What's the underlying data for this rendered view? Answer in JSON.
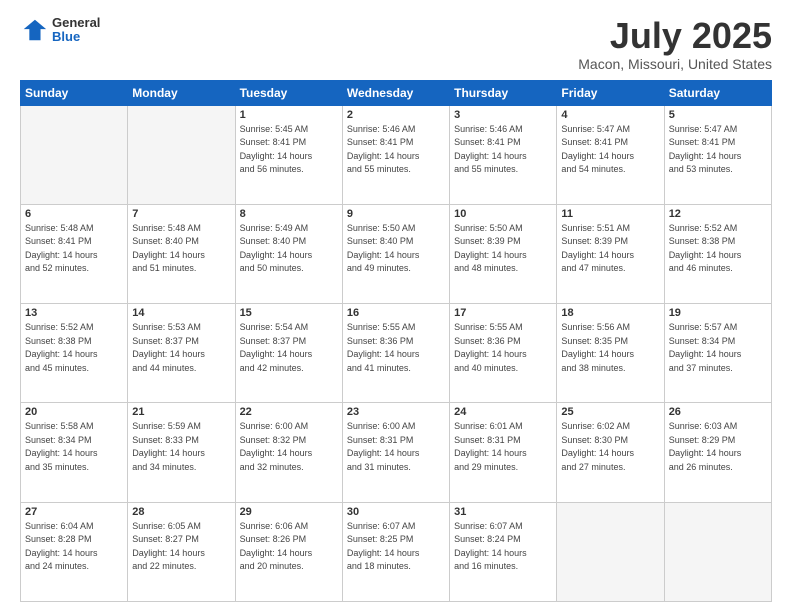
{
  "header": {
    "logo_general": "General",
    "logo_blue": "Blue",
    "title": "July 2025",
    "subtitle": "Macon, Missouri, United States"
  },
  "days_of_week": [
    "Sunday",
    "Monday",
    "Tuesday",
    "Wednesday",
    "Thursday",
    "Friday",
    "Saturday"
  ],
  "weeks": [
    [
      {
        "num": "",
        "info": ""
      },
      {
        "num": "",
        "info": ""
      },
      {
        "num": "1",
        "info": "Sunrise: 5:45 AM\nSunset: 8:41 PM\nDaylight: 14 hours\nand 56 minutes."
      },
      {
        "num": "2",
        "info": "Sunrise: 5:46 AM\nSunset: 8:41 PM\nDaylight: 14 hours\nand 55 minutes."
      },
      {
        "num": "3",
        "info": "Sunrise: 5:46 AM\nSunset: 8:41 PM\nDaylight: 14 hours\nand 55 minutes."
      },
      {
        "num": "4",
        "info": "Sunrise: 5:47 AM\nSunset: 8:41 PM\nDaylight: 14 hours\nand 54 minutes."
      },
      {
        "num": "5",
        "info": "Sunrise: 5:47 AM\nSunset: 8:41 PM\nDaylight: 14 hours\nand 53 minutes."
      }
    ],
    [
      {
        "num": "6",
        "info": "Sunrise: 5:48 AM\nSunset: 8:41 PM\nDaylight: 14 hours\nand 52 minutes."
      },
      {
        "num": "7",
        "info": "Sunrise: 5:48 AM\nSunset: 8:40 PM\nDaylight: 14 hours\nand 51 minutes."
      },
      {
        "num": "8",
        "info": "Sunrise: 5:49 AM\nSunset: 8:40 PM\nDaylight: 14 hours\nand 50 minutes."
      },
      {
        "num": "9",
        "info": "Sunrise: 5:50 AM\nSunset: 8:40 PM\nDaylight: 14 hours\nand 49 minutes."
      },
      {
        "num": "10",
        "info": "Sunrise: 5:50 AM\nSunset: 8:39 PM\nDaylight: 14 hours\nand 48 minutes."
      },
      {
        "num": "11",
        "info": "Sunrise: 5:51 AM\nSunset: 8:39 PM\nDaylight: 14 hours\nand 47 minutes."
      },
      {
        "num": "12",
        "info": "Sunrise: 5:52 AM\nSunset: 8:38 PM\nDaylight: 14 hours\nand 46 minutes."
      }
    ],
    [
      {
        "num": "13",
        "info": "Sunrise: 5:52 AM\nSunset: 8:38 PM\nDaylight: 14 hours\nand 45 minutes."
      },
      {
        "num": "14",
        "info": "Sunrise: 5:53 AM\nSunset: 8:37 PM\nDaylight: 14 hours\nand 44 minutes."
      },
      {
        "num": "15",
        "info": "Sunrise: 5:54 AM\nSunset: 8:37 PM\nDaylight: 14 hours\nand 42 minutes."
      },
      {
        "num": "16",
        "info": "Sunrise: 5:55 AM\nSunset: 8:36 PM\nDaylight: 14 hours\nand 41 minutes."
      },
      {
        "num": "17",
        "info": "Sunrise: 5:55 AM\nSunset: 8:36 PM\nDaylight: 14 hours\nand 40 minutes."
      },
      {
        "num": "18",
        "info": "Sunrise: 5:56 AM\nSunset: 8:35 PM\nDaylight: 14 hours\nand 38 minutes."
      },
      {
        "num": "19",
        "info": "Sunrise: 5:57 AM\nSunset: 8:34 PM\nDaylight: 14 hours\nand 37 minutes."
      }
    ],
    [
      {
        "num": "20",
        "info": "Sunrise: 5:58 AM\nSunset: 8:34 PM\nDaylight: 14 hours\nand 35 minutes."
      },
      {
        "num": "21",
        "info": "Sunrise: 5:59 AM\nSunset: 8:33 PM\nDaylight: 14 hours\nand 34 minutes."
      },
      {
        "num": "22",
        "info": "Sunrise: 6:00 AM\nSunset: 8:32 PM\nDaylight: 14 hours\nand 32 minutes."
      },
      {
        "num": "23",
        "info": "Sunrise: 6:00 AM\nSunset: 8:31 PM\nDaylight: 14 hours\nand 31 minutes."
      },
      {
        "num": "24",
        "info": "Sunrise: 6:01 AM\nSunset: 8:31 PM\nDaylight: 14 hours\nand 29 minutes."
      },
      {
        "num": "25",
        "info": "Sunrise: 6:02 AM\nSunset: 8:30 PM\nDaylight: 14 hours\nand 27 minutes."
      },
      {
        "num": "26",
        "info": "Sunrise: 6:03 AM\nSunset: 8:29 PM\nDaylight: 14 hours\nand 26 minutes."
      }
    ],
    [
      {
        "num": "27",
        "info": "Sunrise: 6:04 AM\nSunset: 8:28 PM\nDaylight: 14 hours\nand 24 minutes."
      },
      {
        "num": "28",
        "info": "Sunrise: 6:05 AM\nSunset: 8:27 PM\nDaylight: 14 hours\nand 22 minutes."
      },
      {
        "num": "29",
        "info": "Sunrise: 6:06 AM\nSunset: 8:26 PM\nDaylight: 14 hours\nand 20 minutes."
      },
      {
        "num": "30",
        "info": "Sunrise: 6:07 AM\nSunset: 8:25 PM\nDaylight: 14 hours\nand 18 minutes."
      },
      {
        "num": "31",
        "info": "Sunrise: 6:07 AM\nSunset: 8:24 PM\nDaylight: 14 hours\nand 16 minutes."
      },
      {
        "num": "",
        "info": ""
      },
      {
        "num": "",
        "info": ""
      }
    ]
  ]
}
